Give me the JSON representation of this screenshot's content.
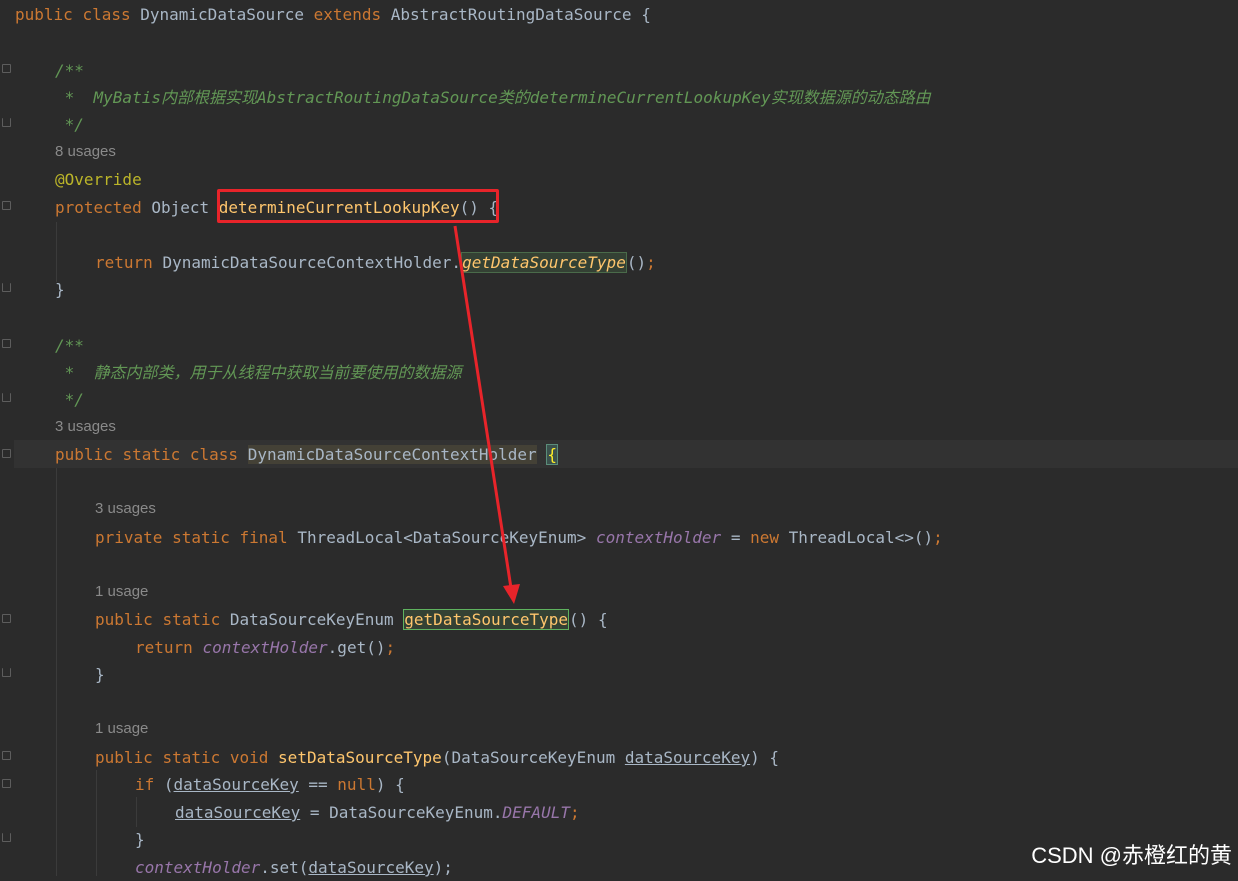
{
  "code": {
    "class_decl": {
      "kw1": "public",
      "kw2": "class",
      "name": "DynamicDataSource",
      "kw3": "extends",
      "parent": "AbstractRoutingDataSource",
      "brace": "{"
    },
    "doc1": {
      "open": "/**",
      "text": " *  MyBatis内部根据实现AbstractRoutingDataSource类的determineCurrentLookupKey实现数据源的动态路由",
      "close": " */"
    },
    "usages_determine": "8 usages",
    "override": "@Override",
    "determine_decl": {
      "kw": "protected",
      "type": "Object",
      "name": "determineCurrentLookupKey",
      "parens": "()",
      "brace": " {"
    },
    "return_line": {
      "kw": "return",
      "holder": "DynamicDataSourceContextHolder",
      "dot": ".",
      "call": "getDataSourceType",
      "tail": "()",
      "semi": ";"
    },
    "close_brace_1": "}",
    "doc2": {
      "open": "/**",
      "text": " *  静态内部类，用于从线程中获取当前要使用的数据源",
      "close": " */"
    },
    "usages_holder": "3 usages",
    "holder_decl": {
      "kw1": "public",
      "kw2": "static",
      "kw3": "class",
      "name": "DynamicDataSourceContextHolder",
      "brace": "{"
    },
    "usages_field": "3 usages",
    "field_decl": {
      "kw1": "private",
      "kw2": "static",
      "kw3": "final",
      "type": "ThreadLocal<DataSourceKeyEnum>",
      "name": "contextHolder",
      "eq": " = ",
      "kw_new": "new",
      "init": "ThreadLocal<>()",
      "semi": ";"
    },
    "usages_get": "1 usage",
    "get_decl": {
      "kw1": "public",
      "kw2": "static",
      "type": "DataSourceKeyEnum",
      "name": "getDataSourceType",
      "tail": "() {"
    },
    "get_return": {
      "kw": "return",
      "field": "contextHolder",
      "call": ".get()",
      "semi": ";"
    },
    "close_brace_2": "}",
    "usages_set": "1 usage",
    "set_decl": {
      "kw1": "public",
      "kw2": "static",
      "kw3": "void",
      "name": "setDataSourceType",
      "open": "(",
      "ptype": "DataSourceKeyEnum",
      "pname": "dataSourceKey",
      "tail": ") {"
    },
    "if_line": {
      "kw": "if",
      "open": " (",
      "var": "dataSourceKey",
      "op": " == ",
      "kw_null": "null",
      "tail": ") {"
    },
    "assign_line": {
      "var": "dataSourceKey",
      "eq": " = ",
      "cls": "DataSourceKeyEnum.",
      "const": "DEFAULT",
      "semi": ";"
    },
    "close_brace_3": "}",
    "set_line": {
      "field": "contextHolder",
      "call": ".set(",
      "var": "dataSourceKey",
      "tail": ");"
    }
  },
  "annotation": {
    "box_color": "#e8242a",
    "arrow_color": "#e8242a"
  },
  "watermark": "CSDN @赤橙红的黄"
}
